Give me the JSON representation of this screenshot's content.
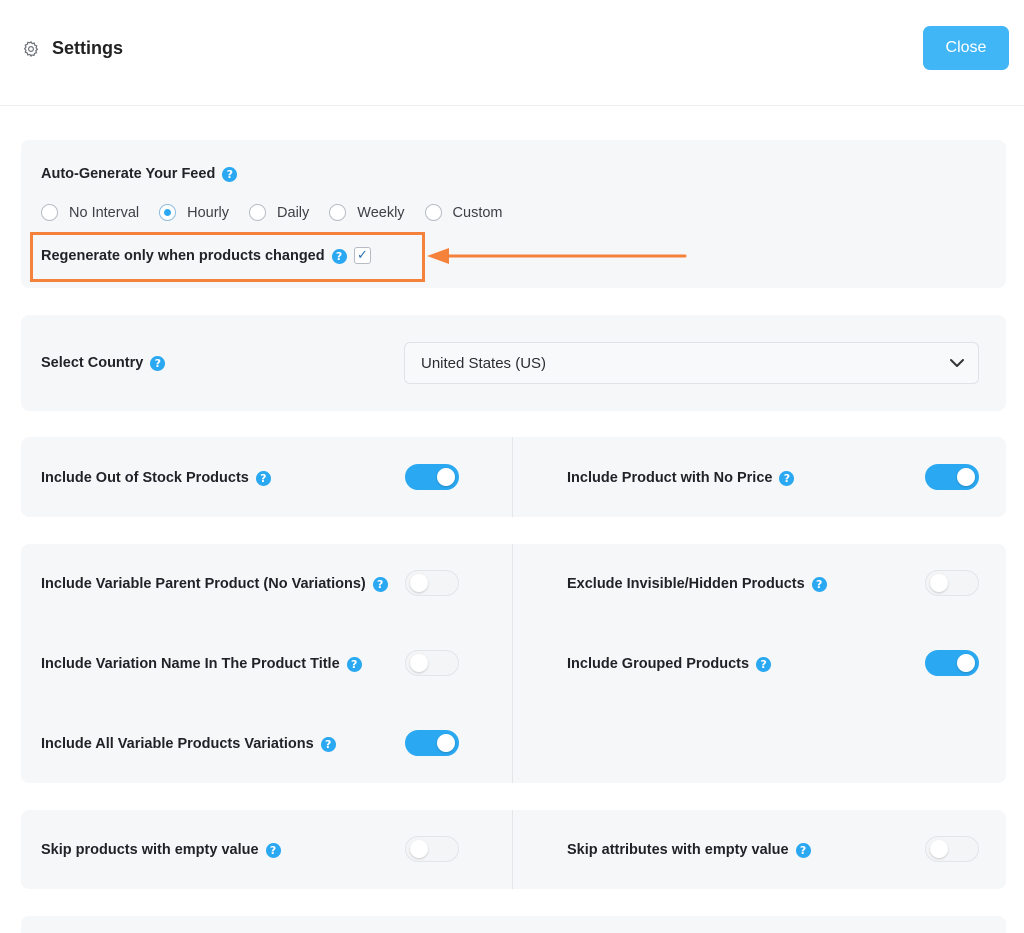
{
  "header": {
    "title": "Settings",
    "close_label": "Close"
  },
  "feed": {
    "label": "Auto-Generate Your Feed",
    "intervals": [
      "No Interval",
      "Hourly",
      "Daily",
      "Weekly",
      "Custom"
    ],
    "selected_interval": "Hourly",
    "regenerate_label": "Regenerate only when products changed",
    "regenerate_checked": true
  },
  "country": {
    "label": "Select Country",
    "selected": "United States (US)"
  },
  "options": {
    "out_of_stock": {
      "label": "Include Out of Stock Products",
      "on": true
    },
    "no_price": {
      "label": "Include Product with No Price",
      "on": true
    },
    "variable_parent": {
      "label": "Include Variable Parent Product (No Variations)",
      "on": false
    },
    "exclude_hidden": {
      "label": "Exclude Invisible/Hidden Products",
      "on": false
    },
    "variation_name": {
      "label": "Include Variation Name In The Product Title",
      "on": false
    },
    "grouped": {
      "label": "Include Grouped Products",
      "on": true
    },
    "all_variations": {
      "label": "Include All Variable Products Variations",
      "on": true
    },
    "skip_empty_value": {
      "label": "Skip products with empty value",
      "on": false
    },
    "skip_empty_attr": {
      "label": "Skip attributes with empty value",
      "on": false
    }
  },
  "help_glyph": "?",
  "colors": {
    "accent": "#2aa8f1",
    "close_button": "#40b6f6",
    "highlight": "#f5823a",
    "card_bg": "#f6f7f9"
  }
}
